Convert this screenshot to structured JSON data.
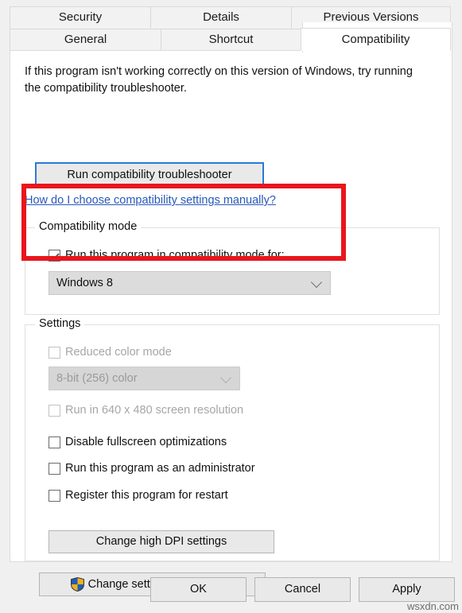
{
  "dialog": {
    "tabs_row1": [
      {
        "label": "Security",
        "active": false
      },
      {
        "label": "Details",
        "active": false
      },
      {
        "label": "Previous Versions",
        "active": false
      }
    ],
    "tabs_row2": [
      {
        "label": "General",
        "active": false
      },
      {
        "label": "Shortcut",
        "active": false
      },
      {
        "label": "Compatibility",
        "active": true
      }
    ],
    "intro_text": "If this program isn't working correctly on this version of Windows, try running the compatibility troubleshooter.",
    "troubleshoot_button": "Run compatibility troubleshooter",
    "help_link": "How do I choose compatibility settings manually?",
    "compatibility_mode": {
      "group_title": "Compatibility mode",
      "checkbox_label": "Run this program in compatibility mode for:",
      "checkbox_checked": "true",
      "selected_os": "Windows 8"
    },
    "settings": {
      "group_title": "Settings",
      "reduced_color_label": "Reduced color mode",
      "color_depth_value": "8-bit (256) color",
      "low_resolution_label": "Run in 640 x 480 screen resolution",
      "disable_fullscreen_label": "Disable fullscreen optimizations",
      "run_as_admin_label": "Run this program as an administrator",
      "register_restart_label": "Register this program for restart",
      "dpi_button": "Change high DPI settings"
    },
    "all_users_button": "Change settings for all users",
    "footer": {
      "ok": "OK",
      "cancel": "Cancel",
      "apply": "Apply"
    },
    "watermark": "wsxdn.com",
    "colors": {
      "annotation_red": "#e8161d",
      "link_blue": "#2858b8",
      "focus_blue": "#2a7ad6",
      "shield_blue": "#1e5fb4",
      "shield_yellow": "#f2b01e"
    }
  }
}
